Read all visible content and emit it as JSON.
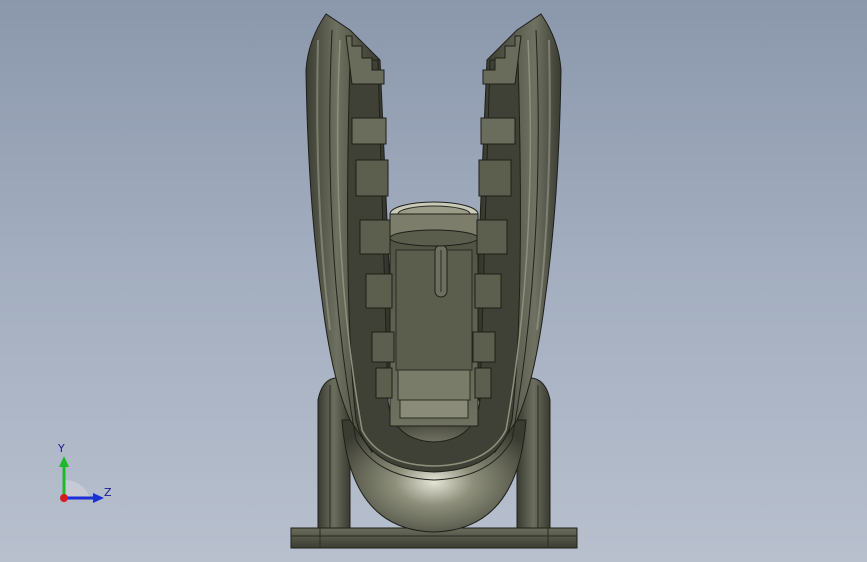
{
  "viewport": {
    "background_top": "#8b97ab",
    "background_bottom": "#b8c0ce",
    "model_color": "#4e5040"
  },
  "triad": {
    "y_label": "Y",
    "z_label": "Z",
    "y_color": "#1fb82a",
    "z_color": "#1b2fd8",
    "x_color": "#d81b1b"
  }
}
